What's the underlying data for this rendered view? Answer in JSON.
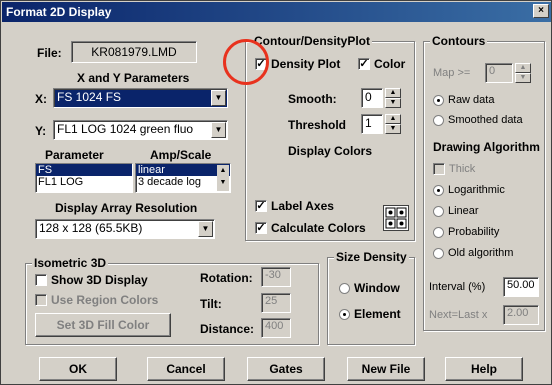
{
  "window": {
    "title": "Format 2D Display",
    "close_glyph": "×"
  },
  "file": {
    "label": "File:",
    "value": "KR081979.LMD"
  },
  "xy_params": {
    "heading": "X and Y Parameters",
    "x_label": "X:",
    "x_value": "FS 1024 FS",
    "y_label": "Y:",
    "y_value": "FL1 LOG 1024 green fluo"
  },
  "param_table": {
    "col1": "Parameter",
    "col2": "Amp/Scale",
    "param_rows": [
      "FS",
      "FL1 LOG"
    ],
    "amp_rows": [
      "linear",
      "3 decade log"
    ]
  },
  "resolution": {
    "heading": "Display Array Resolution",
    "value": "128 x 128 (65.5KB)"
  },
  "contour_density": {
    "title": "Contour/DensityPlot",
    "density_plot": "Density Plot",
    "color": "Color",
    "smooth_label": "Smooth:",
    "smooth_value": "0",
    "threshold_label": "Threshold",
    "threshold_value": "1",
    "display_colors": "Display Colors",
    "label_axes": "Label Axes",
    "calculate_colors": "Calculate Colors"
  },
  "contours": {
    "title": "Contours",
    "map_label": "Map >=",
    "map_value": "0",
    "raw_data": "Raw data",
    "smoothed_data": "Smoothed data",
    "drawing_algorithm": "Drawing Algorithm",
    "thick": "Thick",
    "logarithmic": "Logarithmic",
    "linear": "Linear",
    "probability": "Probability",
    "old_algorithm": "Old algorithm",
    "interval_label": "Interval (%)",
    "interval_value": "50.00",
    "next_last_label": "Next=Last x",
    "next_last_value": "2.00"
  },
  "isometric": {
    "title": "Isometric 3D",
    "show_3d": "Show 3D Display",
    "use_region_colors": "Use Region Colors",
    "set_fill_color": "Set 3D Fill Color",
    "rotation_label": "Rotation:",
    "rotation_value": "-30",
    "tilt_label": "Tilt:",
    "tilt_value": "25",
    "distance_label": "Distance:",
    "distance_value": "400"
  },
  "size_density": {
    "title": "Size Density",
    "window": "Window",
    "element": "Element"
  },
  "buttons": {
    "ok": "OK",
    "cancel": "Cancel",
    "gates": "Gates",
    "new_file": "New File",
    "help": "Help"
  },
  "colors": {
    "title_bar": "#0a246a",
    "highlight_circle": "#e8321e",
    "selection": "#0a246a"
  }
}
